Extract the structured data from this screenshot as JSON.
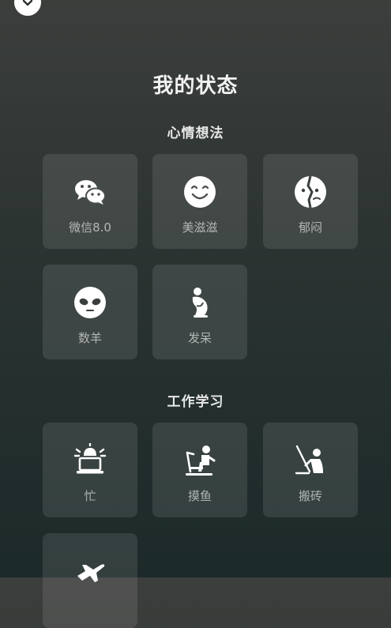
{
  "page": {
    "title": "我的状态"
  },
  "sections": [
    {
      "title": "心情想法",
      "items": [
        {
          "label": "微信8.0",
          "icon": "wechat-icon"
        },
        {
          "label": "美滋滋",
          "icon": "smile-icon"
        },
        {
          "label": "郁闷",
          "icon": "gloomy-face-icon"
        },
        {
          "label": "数羊",
          "icon": "sheep-face-icon"
        },
        {
          "label": "发呆",
          "icon": "daze-person-icon"
        }
      ]
    },
    {
      "title": "工作学习",
      "items": [
        {
          "label": "忙",
          "icon": "siren-laptop-icon"
        },
        {
          "label": "摸鱼",
          "icon": "slacking-person-icon"
        },
        {
          "label": "搬砖",
          "icon": "brick-carrier-icon"
        },
        {
          "label": "",
          "icon": "airplane-icon"
        }
      ]
    }
  ]
}
